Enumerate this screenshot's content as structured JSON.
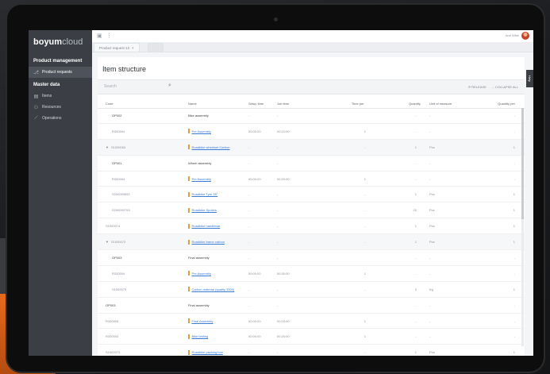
{
  "app": {
    "logo_bold": "boyum",
    "logo_light": "cloud",
    "user_name": "Ann Wise"
  },
  "nav": {
    "section1": "Product management",
    "section1_items": [
      {
        "label": "Product requests",
        "icon": "branch-icon"
      }
    ],
    "section2": "Master data",
    "section2_items": [
      {
        "label": "Items",
        "icon": "box-icon"
      },
      {
        "label": "Resources",
        "icon": "people-icon"
      },
      {
        "label": "Operations",
        "icon": "routing-icon"
      }
    ]
  },
  "tab": {
    "label": "Product request 13",
    "close": "×"
  },
  "help_label": "Help",
  "page_title": "Item structure",
  "search_placeholder": "Search",
  "actions": {
    "release": "RELEASE",
    "collapse": "COLLAPSE ALL"
  },
  "columns": {
    "code": "Code",
    "name": "Name",
    "setup": "Setup time",
    "job": "Job time",
    "time_per": "Time per",
    "quantity": "Quantity",
    "unit": "Unit of measure",
    "qty_per": "Quantity per"
  },
  "rows": [
    {
      "code": "OP002",
      "name": "Bike assembly",
      "name_type": "plain",
      "setup": "-",
      "job": "-",
      "time_per": "",
      "qty": "-",
      "unit": "-",
      "qty_per": "-",
      "grp": false,
      "indent": 1
    },
    {
      "code": "R300004",
      "name": "Pre Assembly",
      "name_type": "link",
      "setup": "00:00:00",
      "job": "00:10:00",
      "time_per": "1",
      "qty": "-",
      "unit": "-",
      "qty_per": "-",
      "grp": false,
      "indent": 1
    },
    {
      "code": "S1000063",
      "name": "Roadbike wheelset Carbon",
      "name_type": "link",
      "setup": "-",
      "job": "-",
      "time_per": "-",
      "qty": "1",
      "unit": "Pcs",
      "qty_per": "1",
      "grp": true,
      "indent": 0,
      "caret": "▼"
    },
    {
      "code": "OP001",
      "name": "Wheel assembly",
      "name_type": "plain",
      "setup": "-",
      "job": "-",
      "time_per": "",
      "qty": "-",
      "unit": "-",
      "qty_per": "-",
      "grp": false,
      "indent": 1
    },
    {
      "code": "R300004",
      "name": "Pre Assembly",
      "name_type": "link",
      "setup": "00:00:00",
      "job": "00:20:00",
      "time_per": "1",
      "qty": "-",
      "unit": "-",
      "qty_per": "-",
      "grp": false,
      "indent": 1
    },
    {
      "code": "S200000652",
      "name": "Roadbike Tyre 28\"",
      "name_type": "link",
      "setup": "-",
      "job": "-",
      "time_per": "-",
      "qty": "1",
      "unit": "Pcs",
      "qty_per": "1",
      "grp": false,
      "indent": 1
    },
    {
      "code": "S200000753",
      "name": "Roadbike Spokes",
      "name_type": "link",
      "setup": "-",
      "job": "-",
      "time_per": "-",
      "qty": "20",
      "unit": "Pcs",
      "qty_per": "1",
      "grp": false,
      "indent": 1
    },
    {
      "code": "S1000074",
      "name": "Roadbike handlebar",
      "name_type": "link",
      "setup": "-",
      "job": "-",
      "time_per": "-",
      "qty": "1",
      "unit": "Pcs",
      "qty_per": "1",
      "grp": false,
      "indent": 0
    },
    {
      "code": "S1000072",
      "name": "Roadbike frame carbon",
      "name_type": "link",
      "setup": "-",
      "job": "-",
      "time_per": "-",
      "qty": "1",
      "unit": "Pcs",
      "qty_per": "1",
      "grp": true,
      "indent": 0,
      "caret": "▼"
    },
    {
      "code": "OP003",
      "name": "Final assembly",
      "name_type": "plain",
      "setup": "-",
      "job": "-",
      "time_per": "",
      "qty": "-",
      "unit": "-",
      "qty_per": "-",
      "grp": false,
      "indent": 1
    },
    {
      "code": "R200004",
      "name": "Pre Assembly",
      "name_type": "link",
      "setup": "00:00:00",
      "job": "00:30:00",
      "time_per": "1",
      "qty": "-",
      "unit": "-",
      "qty_per": "-",
      "grp": false,
      "indent": 1
    },
    {
      "code": "S1000079",
      "name": "Carbon material (quality 3300)",
      "name_type": "link",
      "setup": "-",
      "job": "-",
      "time_per": "-",
      "qty": "3",
      "unit": "Kg",
      "qty_per": "1",
      "grp": false,
      "indent": 1
    },
    {
      "code": "OP003",
      "name": "Final assembly",
      "name_type": "plain",
      "setup": "-",
      "job": "-",
      "time_per": "",
      "qty": "-",
      "unit": "-",
      "qty_per": "-",
      "grp": false,
      "indent": 0
    },
    {
      "code": "R300005",
      "name": "Final Assembly",
      "name_type": "link",
      "setup": "00:00:00",
      "job": "00:15:00",
      "time_per": "1",
      "qty": "-",
      "unit": "-",
      "qty_per": "-",
      "grp": false,
      "indent": 0
    },
    {
      "code": "R300003",
      "name": "Bike testing",
      "name_type": "link",
      "setup": "00:00:00",
      "job": "00:20:00",
      "time_per": "1",
      "qty": "-",
      "unit": "-",
      "qty_per": "-",
      "grp": false,
      "indent": 0
    },
    {
      "code": "S1000073",
      "name": "Roadbike packing box",
      "name_type": "link",
      "setup": "-",
      "job": "-",
      "time_per": "-",
      "qty": "1",
      "unit": "Pcs",
      "qty_per": "1",
      "grp": false,
      "indent": 0
    }
  ]
}
